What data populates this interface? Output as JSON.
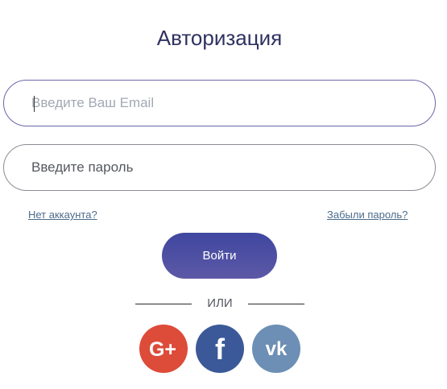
{
  "form": {
    "title": "Авторизация",
    "email_placeholder": "Введите Ваш Email",
    "email_value": "",
    "password_placeholder": "Введите пароль",
    "password_value": "",
    "register_link": "Нет аккаунта?",
    "forgot_link": "Забыли пароль?",
    "login_button": "Войти",
    "divider_text": "ИЛИ"
  },
  "social": [
    {
      "name": "google-plus",
      "icon": "google-plus-icon",
      "color": "#dd4b39",
      "glyph": "G+"
    },
    {
      "name": "facebook",
      "icon": "facebook-icon",
      "color": "#3b5998",
      "glyph": "f"
    },
    {
      "name": "vk",
      "icon": "vk-icon",
      "color": "#6d8fb5",
      "glyph": "vk"
    }
  ],
  "colors": {
    "accent": "#4a4fa3",
    "link": "#4c6c8c",
    "email_border": "#6a66a8",
    "password_border": "#8a8d93"
  }
}
